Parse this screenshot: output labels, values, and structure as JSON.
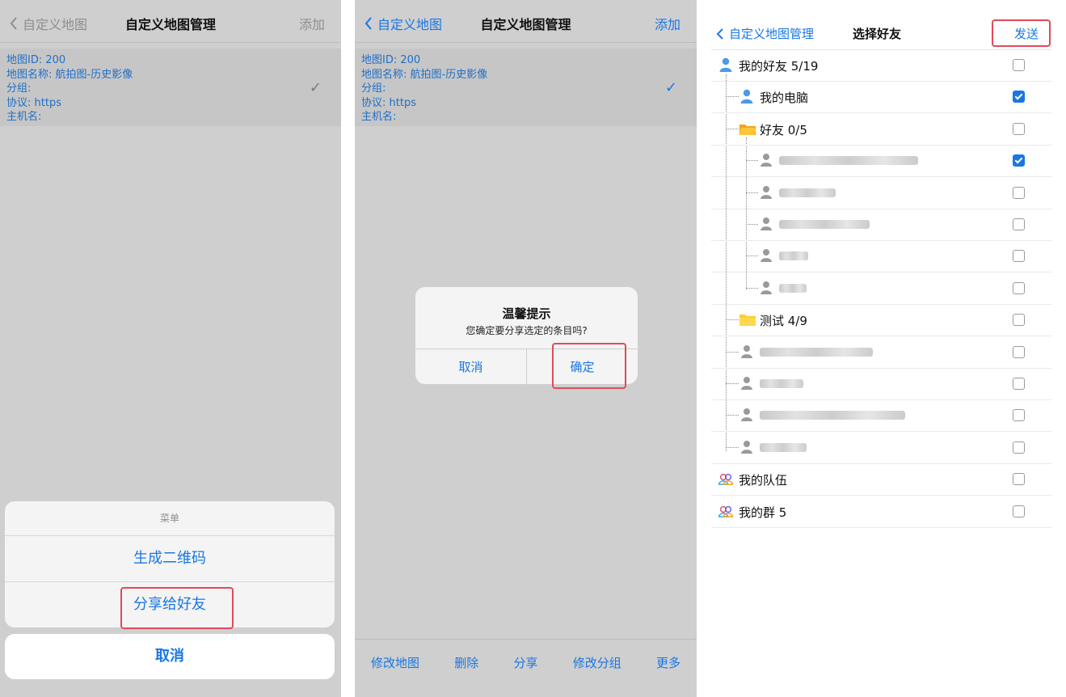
{
  "panel1": {
    "nav": {
      "back_label": "自定义地图",
      "title": "自定义地图管理",
      "add_label": "添加"
    },
    "info": {
      "map_id": "地图ID: 200",
      "map_name": "地图名称: 航拍图-历史影像",
      "group": "分组:",
      "protocol": "协议: https",
      "host": "主机名:"
    },
    "check_mark": "✓",
    "sheet": {
      "header": "菜单",
      "items": [
        "生成二维码",
        "分享给好友"
      ],
      "cancel": "取消"
    }
  },
  "panel2": {
    "nav": {
      "back_label": "自定义地图",
      "title": "自定义地图管理",
      "add_label": "添加"
    },
    "info": {
      "map_id": "地图ID: 200",
      "map_name": "地图名称: 航拍图-历史影像",
      "group": "分组:",
      "protocol": "协议: https",
      "host": "主机名:"
    },
    "check_mark": "✓",
    "dialog": {
      "title": "温馨提示",
      "message": "您确定要分享选定的条目吗?",
      "cancel": "取消",
      "confirm": "确定"
    },
    "toolbar": [
      "修改地图",
      "删除",
      "分享",
      "修改分组",
      "更多"
    ]
  },
  "panel3": {
    "nav": {
      "back_label": "自定义地图管理",
      "title": "选择好友",
      "send_label": "发送"
    },
    "rows": [
      {
        "label": "我的好友 5/19",
        "checked": false
      },
      {
        "label": "我的电脑",
        "checked": true
      },
      {
        "label": "好友 0/5",
        "checked": false
      },
      {
        "label": "",
        "checked": true
      },
      {
        "label": "",
        "checked": false
      },
      {
        "label": "",
        "checked": false
      },
      {
        "label": "",
        "checked": false
      },
      {
        "label": "",
        "checked": false
      },
      {
        "label": "测试 4/9",
        "checked": false
      },
      {
        "label": "",
        "checked": false
      },
      {
        "label": "",
        "checked": false
      },
      {
        "label": "",
        "checked": false
      },
      {
        "label": "",
        "checked": false
      },
      {
        "label": "我的队伍",
        "checked": false
      },
      {
        "label": "我的群 5",
        "checked": false
      }
    ],
    "icons": {
      "user": "user-icon",
      "folder": "folder-icon",
      "team": "team-icon",
      "contact": "contact-icon"
    }
  }
}
